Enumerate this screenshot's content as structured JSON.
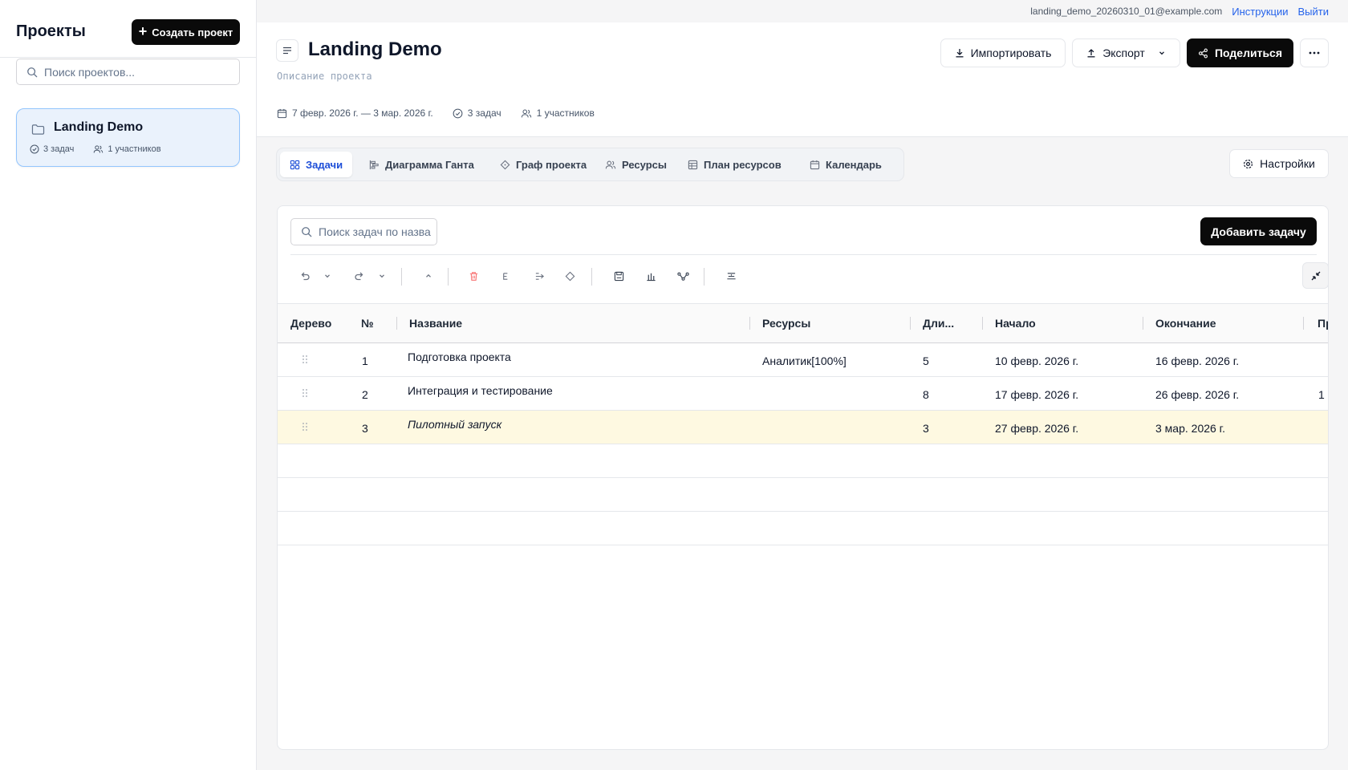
{
  "sidebar": {
    "title": "Проекты",
    "create_button": "Создать проект",
    "search_placeholder": "Поиск проектов...",
    "projects": [
      {
        "name": "Landing Demo",
        "tasks": "3 задач",
        "members": "1 участников"
      }
    ]
  },
  "topbar": {
    "email": "landing_demo_20260310_01@example.com",
    "instructions": "Инструкции",
    "logout": "Выйти"
  },
  "project": {
    "title": "Landing Demo",
    "description": "Описание проекта",
    "dates": "7 февр. 2026 г. — 3 мар. 2026 г.",
    "tasks": "3 задач",
    "members": "1 участников",
    "import_button": "Импортировать",
    "export_button": "Экспорт",
    "share_button": "Поделиться"
  },
  "tabs": [
    {
      "label": "Задачи",
      "active": true
    },
    {
      "label": "Диаграмма Ганта",
      "active": false
    },
    {
      "label": "Граф проекта",
      "active": false
    },
    {
      "label": "Ресурсы",
      "active": false
    },
    {
      "label": "План ресурсов",
      "active": false
    },
    {
      "label": "Календарь",
      "active": false
    }
  ],
  "settings_button": "Настройки",
  "tasks_panel": {
    "search_placeholder": "Поиск задач по названию",
    "add_button": "Добавить задачу",
    "columns": [
      "Дерево",
      "№",
      "Название",
      "Ресурсы",
      "Дли...",
      "Начало",
      "Окончание",
      "Пр"
    ],
    "rows": [
      {
        "num": "1",
        "name": "Подготовка проекта",
        "resources": "Аналитик[100%]",
        "duration": "5",
        "start": "10 февр. 2026 г.",
        "end": "16 февр. 2026 г.",
        "pred": ""
      },
      {
        "num": "2",
        "name": "Интеграция и тестирование",
        "resources": "",
        "duration": "8",
        "start": "17 февр. 2026 г.",
        "end": "26 февр. 2026 г.",
        "pred": "1"
      },
      {
        "num": "3",
        "name": "Пилотный запуск",
        "resources": "",
        "duration": "3",
        "start": "27 февр. 2026 г.",
        "end": "3 мар. 2026 г.",
        "pred": ""
      }
    ]
  },
  "colors": {
    "accent_blue": "#1d4ed8",
    "link_blue": "#2563eb",
    "dark_button": "#0a0a0a",
    "selected_row": "#fef9e1",
    "delete_red": "#f87171"
  }
}
